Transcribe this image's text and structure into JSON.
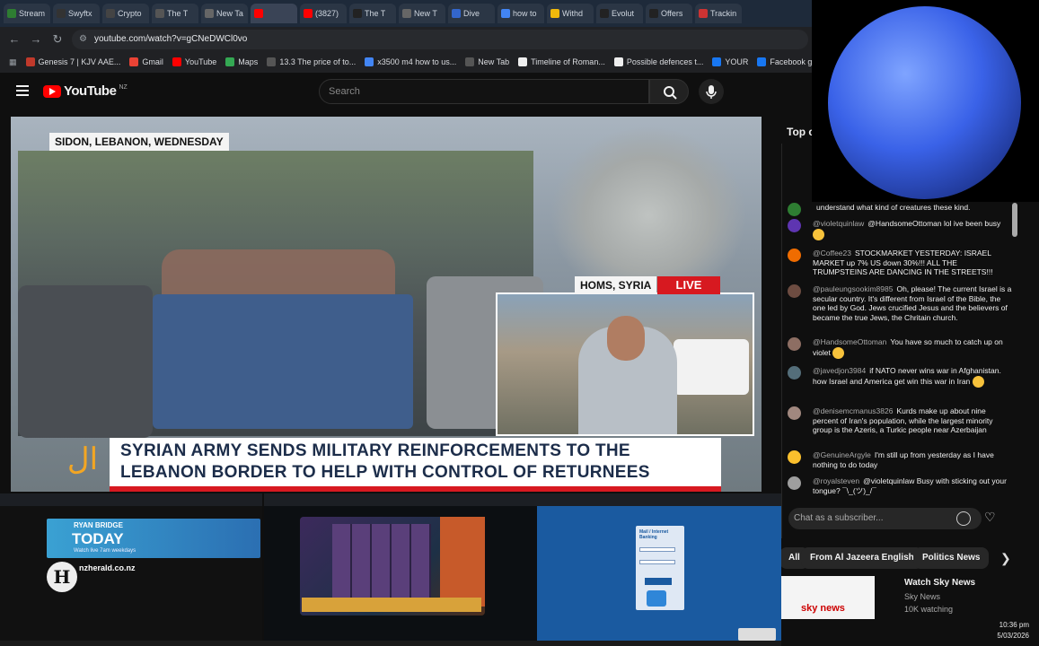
{
  "tabs": [
    {
      "label": "Stream",
      "color": "#2e7d32",
      "active": false
    },
    {
      "label": "Swyftx",
      "color": "#333333",
      "active": false
    },
    {
      "label": "Crypto",
      "color": "#444444",
      "active": false
    },
    {
      "label": "The T",
      "color": "#555555",
      "active": false
    },
    {
      "label": "New Ta",
      "color": "#666666",
      "active": false
    },
    {
      "label": "",
      "color": "#ff0000",
      "active": true
    },
    {
      "label": "(3827)",
      "color": "#ff0000",
      "active": false
    },
    {
      "label": "The T",
      "color": "#222222",
      "active": false
    },
    {
      "label": "New T",
      "color": "#666666",
      "active": false
    },
    {
      "label": "Dive",
      "color": "#3366cc",
      "active": false
    },
    {
      "label": "how to",
      "color": "#4285f4",
      "active": false
    },
    {
      "label": "Withd",
      "color": "#f0b90b",
      "active": false
    },
    {
      "label": "Evolut",
      "color": "#222222",
      "active": false
    },
    {
      "label": "Offers",
      "color": "#222222",
      "active": false
    },
    {
      "label": "Trackin",
      "color": "#cc3333",
      "active": false
    }
  ],
  "address": {
    "url": "youtube.com/watch?v=gCNeDWCl0vo"
  },
  "bookmarks": [
    {
      "label": "Genesis 7 | KJV AAE...",
      "color": "#c0392b"
    },
    {
      "label": "Gmail",
      "color": "#ea4335"
    },
    {
      "label": "YouTube",
      "color": "#ff0000"
    },
    {
      "label": "Maps",
      "color": "#34a853"
    },
    {
      "label": "13.3 The price of to...",
      "color": "#555555"
    },
    {
      "label": "x3500 m4 how to us...",
      "color": "#4285f4"
    },
    {
      "label": "New Tab",
      "color": "#555555"
    },
    {
      "label": "Timeline of Roman...",
      "color": "#eeeeee"
    },
    {
      "label": "Possible defences t...",
      "color": "#eeeeee"
    },
    {
      "label": "YOUR",
      "color": "#1877f2"
    },
    {
      "label": "Facebook green",
      "color": "#1877f2"
    }
  ],
  "youtube": {
    "logo": "YouTube",
    "country": "NZ",
    "search_placeholder": "Search",
    "icons": {
      "menu": "menu-icon",
      "search": "search-icon",
      "mic": "mic-icon"
    }
  },
  "video": {
    "location_tag": "SIDON, LEBANON, WEDNESDAY",
    "inset_tag": "HOMS, SYRIA",
    "live_tag": "LIVE",
    "headline_line1": "SYRIAN ARMY SENDS MILITARY REINFORCEMENTS TO THE",
    "headline_line2": "LEBANON BORDER TO HELP WITH CONTROL OF RETURNEES",
    "channel_logo": "aljazeera-logo"
  },
  "chat": {
    "header": "Top c",
    "messages": [
      {
        "author": "",
        "text": "understand what kind of creatures these kind.",
        "avatar_color": "#2e7d32",
        "emoji": false
      },
      {
        "author": "@violetquinlaw",
        "text": "@HandsomeOttoman lol ive been busy",
        "avatar_color": "#5e35b1",
        "emoji": true
      },
      {
        "author": "@Coffee23",
        "text": "STOCKMARKET YESTERDAY: ISRAEL MARKET up 7% US down 30%!!! ALL THE TRUMPSTEINS ARE DANCING IN THE STREETS!!!",
        "avatar_color": "#ef6c00",
        "emoji": false
      },
      {
        "author": "@pauleungsookim8985",
        "text": "Oh, please! The current Israel is a secular country. It's different from Israel of the Bible, the one led by God. Jews crucified Jesus and the believers of became the true Jews, the Chritain church.",
        "avatar_color": "#6d4c41",
        "emoji": false
      },
      {
        "author": "@HandsomeOttoman",
        "text": "You have so much to catch up on violet",
        "avatar_color": "#8d6e63",
        "emoji": true
      },
      {
        "author": "@javedjon3984",
        "text": "if NATO never wins war in Afghanistan. how Israel and America get win this war in Iran",
        "avatar_color": "#546e7a",
        "emoji": true
      },
      {
        "author": "@denisemcmanus3826",
        "text": "Kurds make up about nine percent of Iran's population, while the largest minority group is the Azeris, a Turkic people near Azerbaijan",
        "avatar_color": "#a1887f",
        "emoji": false
      },
      {
        "author": "@GenuineArgyle",
        "text": "I'm still up from yesterday as I have nothing to do today",
        "avatar_color": "#fbc02d",
        "emoji": false
      },
      {
        "author": "@royalsteven",
        "text": "@violetquinlaw Busy with sticking out your tongue? ¯\\_(ツ)_/¯",
        "avatar_color": "#9e9e9e",
        "emoji": false
      }
    ],
    "input_placeholder": "Chat as a subscriber...",
    "icons": {
      "emoji": "emoji-icon",
      "heart": "heart-icon"
    }
  },
  "chips": [
    "All",
    "From Al Jazeera English",
    "Politics News"
  ],
  "related": {
    "title": "Watch Sky News",
    "channel": "Sky News",
    "watching": "10K watching",
    "thumb_logo": "sky news"
  },
  "thumbnails": {
    "thumb1": {
      "banner_line1": "RYAN BRIDGE",
      "banner_line2": "TODAY",
      "banner_line3": "Watch live 7am weekdays",
      "channel": "nzherald.co.nz"
    },
    "thumb3": {
      "login_title": "Mail / Internet Banking"
    }
  },
  "system": {
    "time": "10:36 pm",
    "date": "5/03/2026"
  }
}
